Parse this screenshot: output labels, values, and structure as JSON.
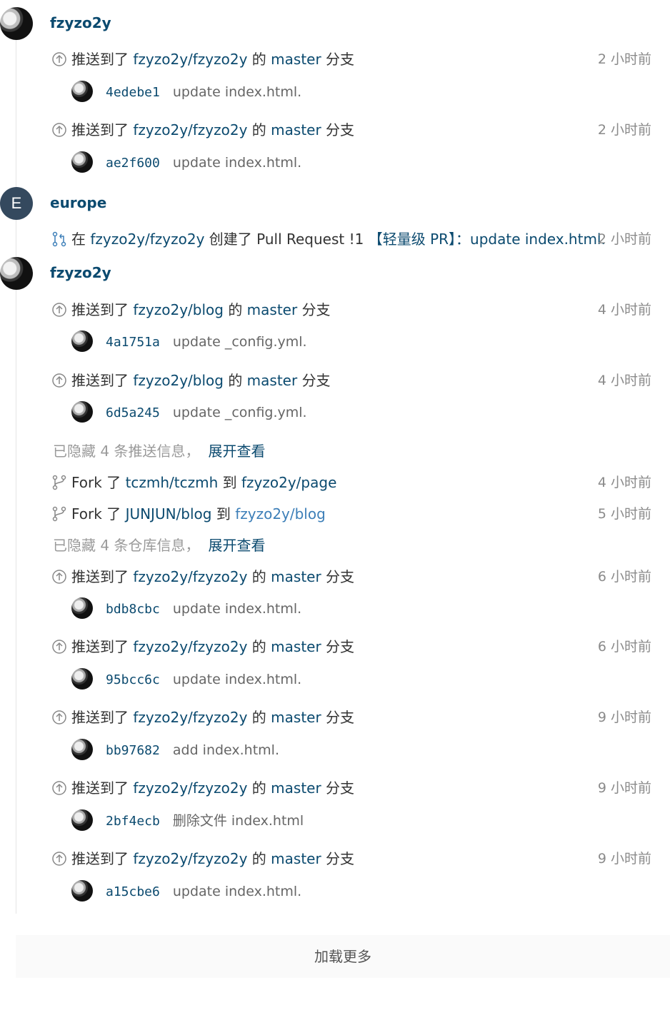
{
  "groups": [
    {
      "user": "fzyzo2y",
      "avatar": "photo"
    },
    {
      "user": "europe",
      "avatar": "letter",
      "letter": "E"
    },
    {
      "user": "fzyzo2y",
      "avatar": "photo"
    }
  ],
  "events": [
    {
      "type": "push",
      "action": "推送到了",
      "repo": "fzyzo2y/fzyzo2y",
      "mid": "的",
      "branch": "master",
      "tail": "分支",
      "time": "2 小时前",
      "sha": "4edebe1",
      "msg": "update index.html."
    },
    {
      "type": "push",
      "action": "推送到了",
      "repo": "fzyzo2y/fzyzo2y",
      "mid": "的",
      "branch": "master",
      "tail": "分支",
      "time": "2 小时前",
      "sha": "ae2f600",
      "msg": "update index.html."
    },
    {
      "type": "pr",
      "pre": "在",
      "repo": "fzyzo2y/fzyzo2y",
      "mid": "创建了 Pull Request !1",
      "title": "【轻量级 PR】：update index.html.",
      "time": "2 小时前"
    },
    {
      "type": "push",
      "action": "推送到了",
      "repo": "fzyzo2y/blog",
      "mid": "的",
      "branch": "master",
      "tail": "分支",
      "time": "4 小时前",
      "sha": "4a1751a",
      "msg": "update _config.yml."
    },
    {
      "type": "push",
      "action": "推送到了",
      "repo": "fzyzo2y/blog",
      "mid": "的",
      "branch": "master",
      "tail": "分支",
      "time": "4 小时前",
      "sha": "6d5a245",
      "msg": "update _config.yml."
    },
    {
      "type": "fork",
      "pre": "Fork 了",
      "src": "tczmh/tczmh",
      "mid": "到",
      "dst": "fzyzo2y/page",
      "time": "4 小时前"
    },
    {
      "type": "fork",
      "pre": "Fork 了",
      "src": "JUNJUN/blog",
      "mid": "到",
      "dst": "fzyzo2y/blog",
      "time": "5 小时前"
    },
    {
      "type": "push",
      "action": "推送到了",
      "repo": "fzyzo2y/fzyzo2y",
      "mid": "的",
      "branch": "master",
      "tail": "分支",
      "time": "6 小时前",
      "sha": "bdb8cbc",
      "msg": "update index.html."
    },
    {
      "type": "push",
      "action": "推送到了",
      "repo": "fzyzo2y/fzyzo2y",
      "mid": "的",
      "branch": "master",
      "tail": "分支",
      "time": "6 小时前",
      "sha": "95bcc6c",
      "msg": "update index.html."
    },
    {
      "type": "push",
      "action": "推送到了",
      "repo": "fzyzo2y/fzyzo2y",
      "mid": "的",
      "branch": "master",
      "tail": "分支",
      "time": "9 小时前",
      "sha": "bb97682",
      "msg": "add index.html."
    },
    {
      "type": "push",
      "action": "推送到了",
      "repo": "fzyzo2y/fzyzo2y",
      "mid": "的",
      "branch": "master",
      "tail": "分支",
      "time": "9 小时前",
      "sha": "2bf4ecb",
      "msg": "删除文件 index.html"
    },
    {
      "type": "push",
      "action": "推送到了",
      "repo": "fzyzo2y/fzyzo2y",
      "mid": "的",
      "branch": "master",
      "tail": "分支",
      "time": "9 小时前",
      "sha": "a15cbe6",
      "msg": "update index.html."
    }
  ],
  "hidden_notes": [
    {
      "text": "已隐藏 4 条推送信息，",
      "expand": "展开查看"
    },
    {
      "text": "已隐藏 4 条仓库信息，",
      "expand": "展开查看"
    }
  ],
  "load_more": "加载更多",
  "colors": {
    "link": "#0b4a6f",
    "link_light": "#3d7fb8",
    "muted": "#8a8a8a",
    "pr_icon": "#3d7fb8"
  }
}
